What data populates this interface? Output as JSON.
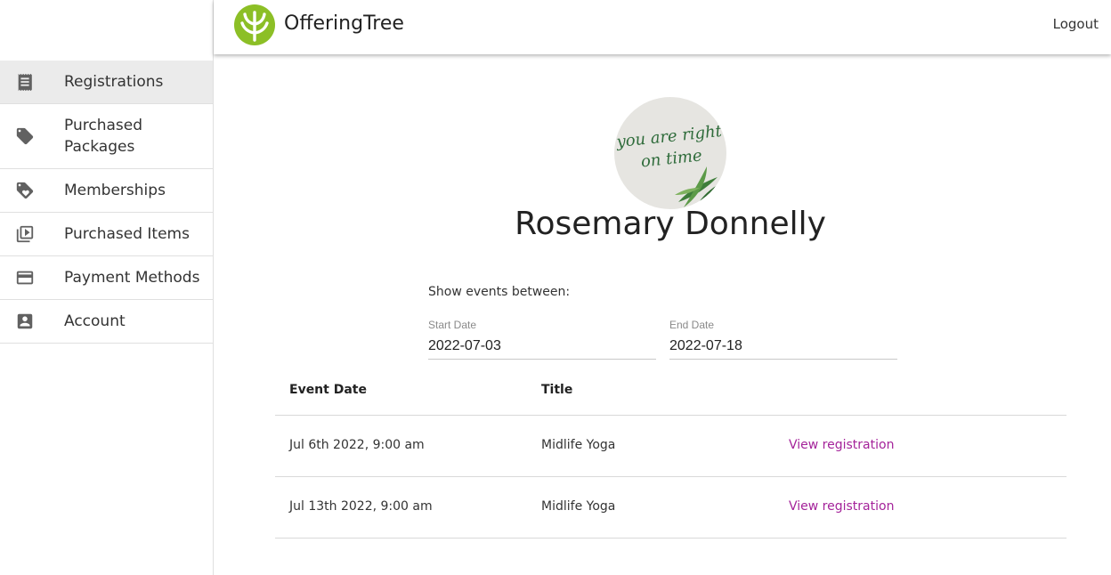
{
  "header": {
    "brand": "OfferingTree",
    "logout_label": "Logout",
    "logo_color": "#8cbf26"
  },
  "sidebar": {
    "items": [
      {
        "label": "Registrations",
        "icon": "receipt-icon",
        "active": true
      },
      {
        "label": "Purchased Packages",
        "icon": "tag-icon",
        "active": false
      },
      {
        "label": "Memberships",
        "icon": "tags-icon",
        "active": false
      },
      {
        "label": "Purchased Items",
        "icon": "video-library-icon",
        "active": false
      },
      {
        "label": "Payment Methods",
        "icon": "credit-card-icon",
        "active": false
      },
      {
        "label": "Account",
        "icon": "account-box-icon",
        "active": false
      }
    ]
  },
  "profile": {
    "avatar_text_line1": "you are right",
    "avatar_text_line2": "on time",
    "name": "Rosemary Donnelly"
  },
  "filter": {
    "label": "Show events between:",
    "start_label": "Start Date",
    "start_value": "2022-07-03",
    "end_label": "End Date",
    "end_value": "2022-07-18"
  },
  "table": {
    "headers": [
      "Event Date",
      "Title"
    ],
    "rows": [
      {
        "date": "Jul 6th 2022, 9:00 am",
        "title": "Midlife Yoga",
        "action": "View registration"
      },
      {
        "date": "Jul 13th 2022, 9:00 am",
        "title": "Midlife Yoga",
        "action": "View registration"
      }
    ]
  },
  "colors": {
    "link": "#a4239a",
    "active_nav_bg": "#ebebeb"
  }
}
